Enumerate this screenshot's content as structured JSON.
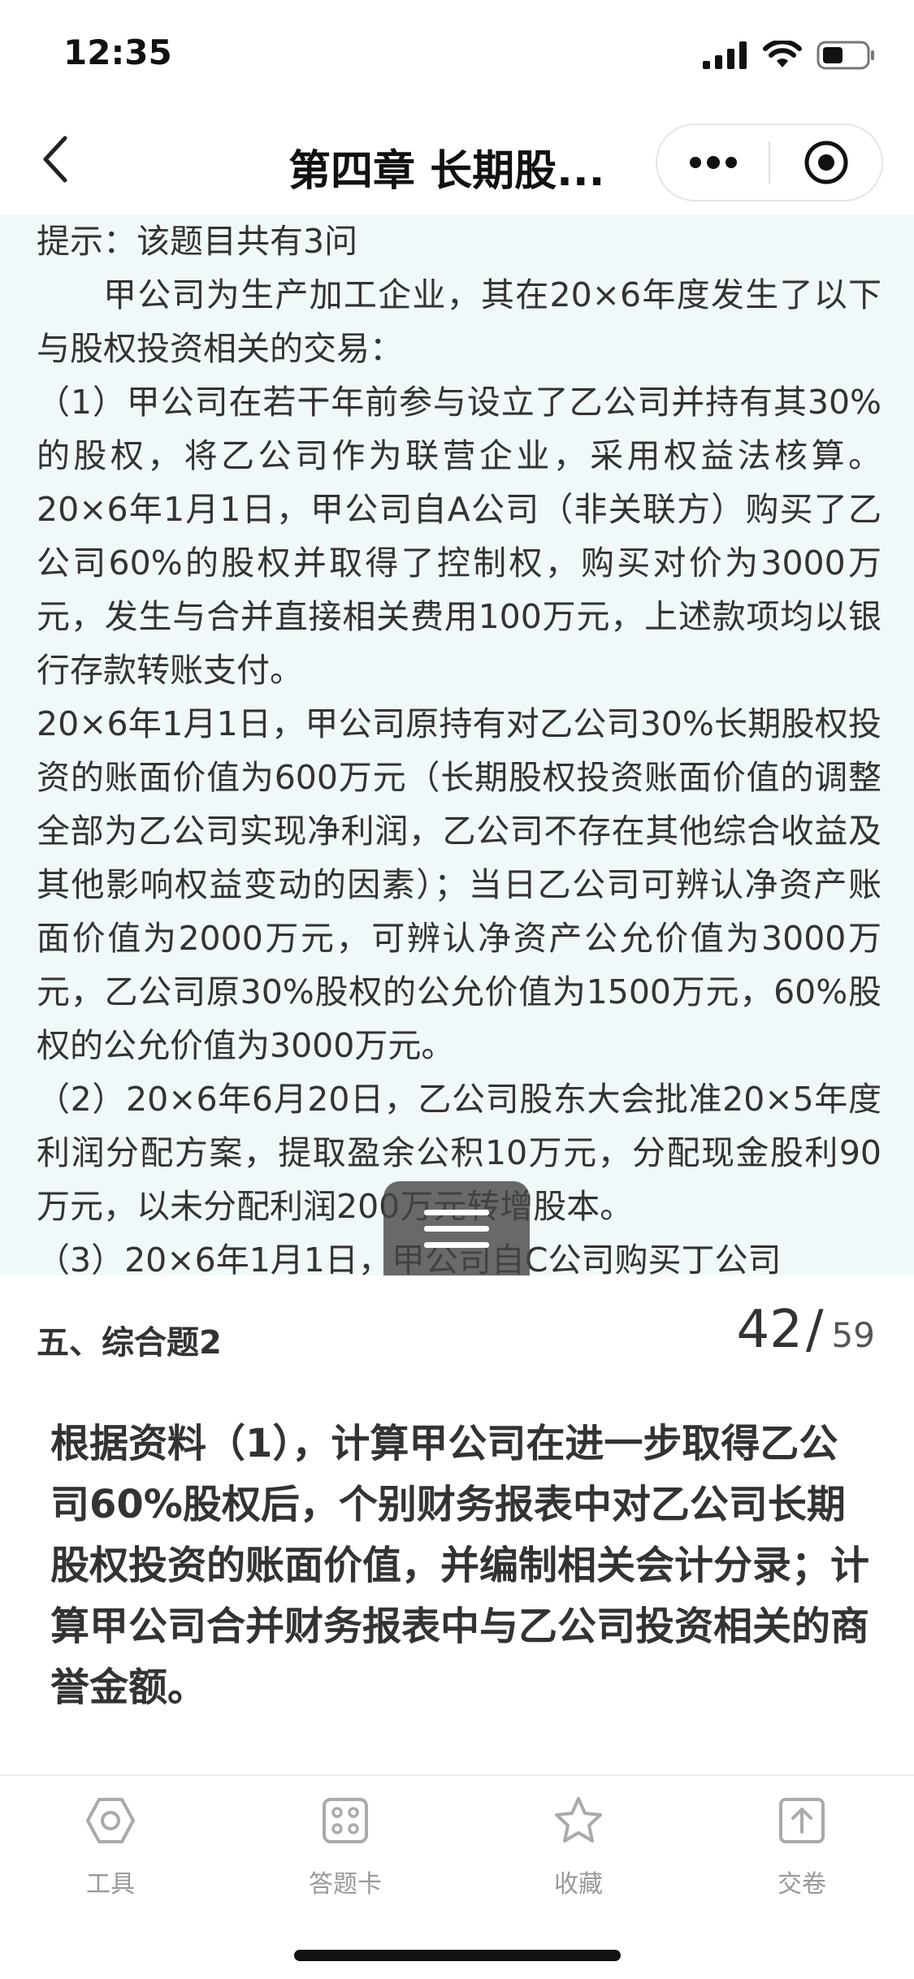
{
  "status_bar": {
    "time": "12:35"
  },
  "nav": {
    "title": "第四章  长期股..."
  },
  "material": {
    "hint": "提示：该题目共有3问",
    "paragraphs": [
      "甲公司为生产加工企业，其在20×6年度发生了以下与股权投资相关的交易：",
      "（1）甲公司在若干年前参与设立了乙公司并持有其30%的股权，将乙公司作为联营企业，采用权益法核算。20×6年1月1日，甲公司自A公司（非关联方）购买了乙公司60%的股权并取得了控制权，购买对价为3000万元，发生与合并直接相关费用100万元，上述款项均以银行存款转账支付。",
      "20×6年1月1日，甲公司原持有对乙公司30%长期股权投资的账面价值为600万元（长期股权投资账面价值的调整全部为乙公司实现净利润，乙公司不存在其他综合收益及其他影响权益变动的因素）；当日乙公司可辨认净资产账面价值为2000万元，可辨认净资产公允价值为3000万元，乙公司原30%股权的公允价值为1500万元，60%股权的公允价值为3000万元。",
      "（2）20×6年6月20日，乙公司股东大会批准20×5年度利润分配方案，提取盈余公积10万元，分配现金股利90万元，以未分配利润200万元转增股本。",
      "（3）20×6年1月1日，甲公司自C公司购买丁公司"
    ]
  },
  "question": {
    "type_label": "五、综合题2",
    "current": "42",
    "slash": "/",
    "total": "59",
    "text": "根据资料（1），计算甲公司在进一步取得乙公司60%股权后，个别财务报表中对乙公司长期股权投资的账面价值，并编制相关会计分录；计算甲公司合并财务报表中与乙公司投资相关的商誉金额。"
  },
  "toolbar": {
    "items": [
      {
        "label": "工具",
        "icon": "hexagon-tool-icon"
      },
      {
        "label": "答题卡",
        "icon": "answer-card-icon"
      },
      {
        "label": "收藏",
        "icon": "star-icon"
      },
      {
        "label": "交卷",
        "icon": "submit-upload-icon"
      }
    ]
  },
  "colors": {
    "material_background": "#f1f8f9",
    "toolbar_icon": "#aaaaaa",
    "text": "#333333"
  }
}
